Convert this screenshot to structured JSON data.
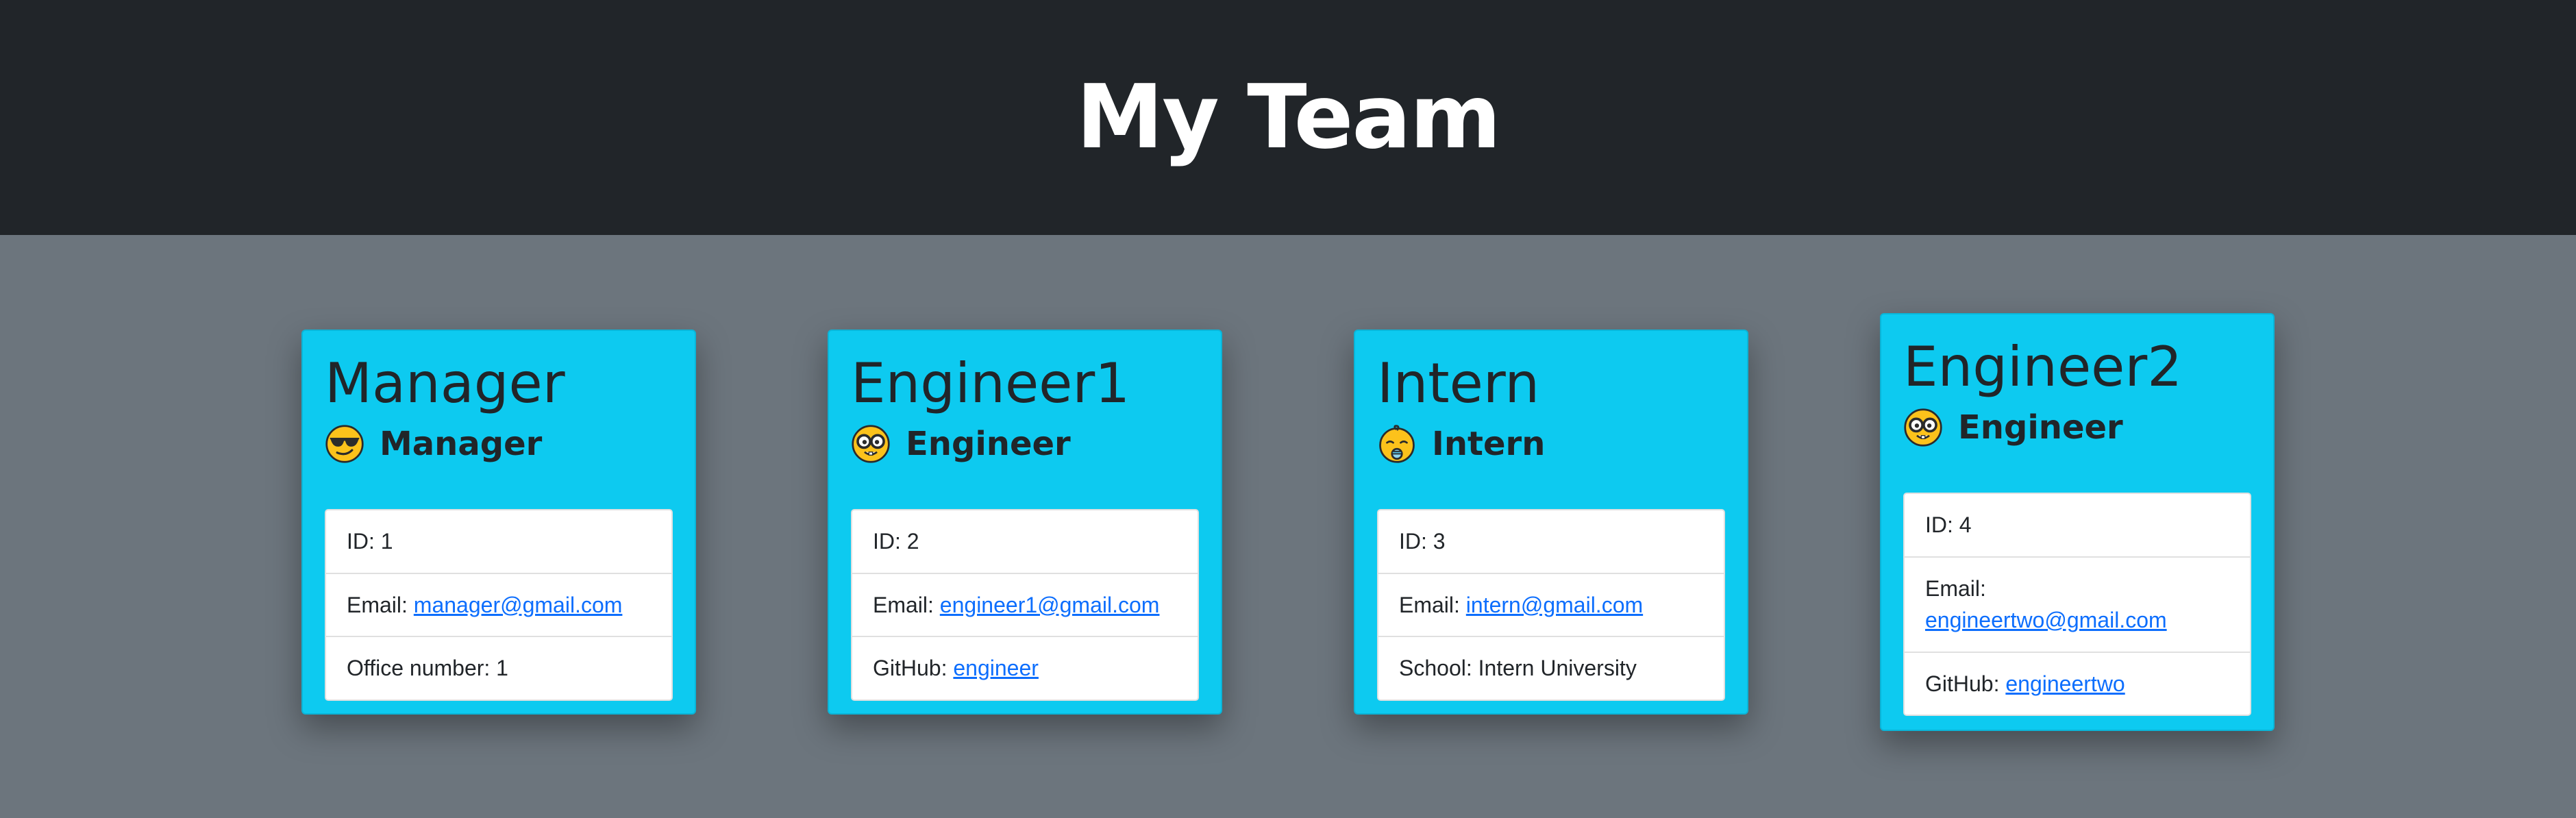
{
  "header": {
    "title": "My Team"
  },
  "cards": [
    {
      "name": "Manager",
      "role": "Manager",
      "role_icon": "sunglasses-face-icon",
      "items": [
        {
          "label": "ID: ",
          "value": "1"
        },
        {
          "label": "Email: ",
          "link": "manager@gmail.com"
        },
        {
          "label": "Office number: ",
          "value": "1"
        }
      ]
    },
    {
      "name": "Engineer1",
      "role": "Engineer",
      "role_icon": "nerd-face-icon",
      "items": [
        {
          "label": "ID: ",
          "value": "2"
        },
        {
          "label": "Email: ",
          "link": "engineer1@gmail.com"
        },
        {
          "label": "GitHub: ",
          "link": "engineer"
        }
      ]
    },
    {
      "name": "Intern",
      "role": "Intern",
      "role_icon": "baby-face-icon",
      "items": [
        {
          "label": "ID: ",
          "value": "3"
        },
        {
          "label": "Email: ",
          "link": "intern@gmail.com"
        },
        {
          "label": "School: ",
          "value": "Intern University"
        }
      ]
    },
    {
      "name": "Engineer2",
      "role": "Engineer",
      "role_icon": "nerd-face-icon",
      "items": [
        {
          "label": "ID: ",
          "value": "4"
        },
        {
          "label": "Email: ",
          "link": "engineertwo@gmail.com"
        },
        {
          "label": "GitHub: ",
          "link": "engineertwo"
        }
      ]
    }
  ],
  "colors": {
    "header_bg": "#212529",
    "page_bg": "#6c757d",
    "card_bg": "#0dcaf0",
    "link": "#0d6efd"
  }
}
